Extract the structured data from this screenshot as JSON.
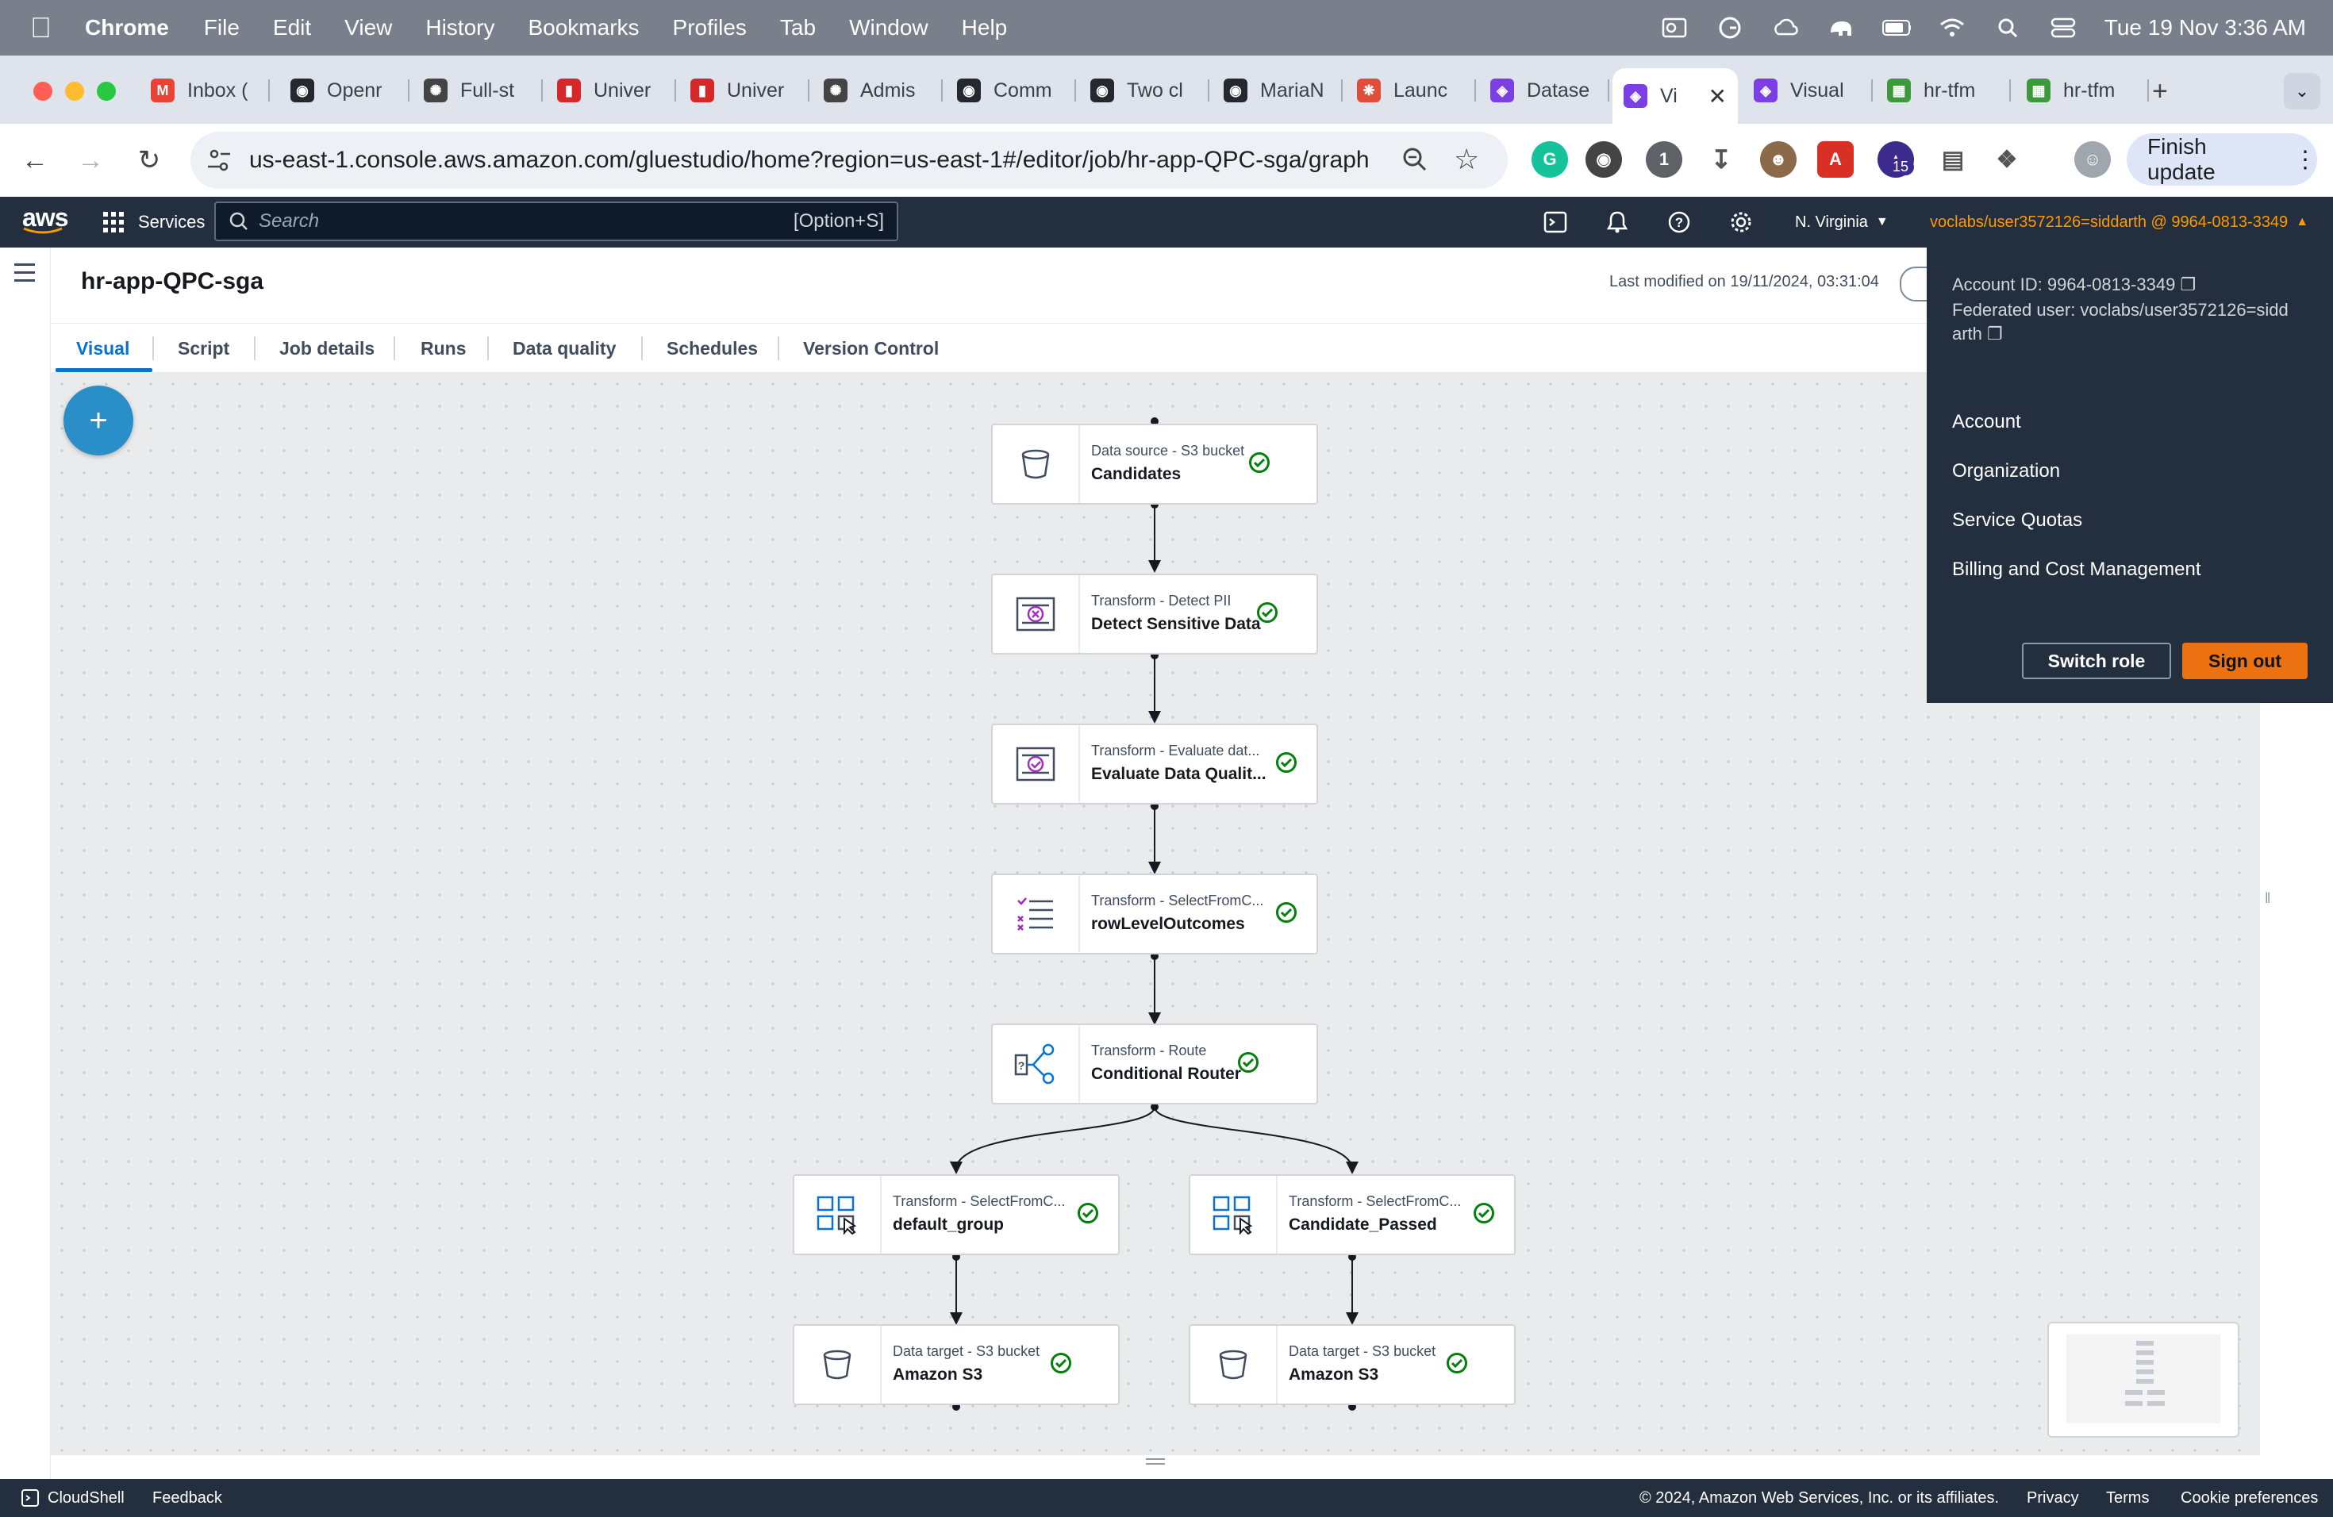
{
  "menubar": {
    "app": "Chrome",
    "items": [
      "File",
      "Edit",
      "View",
      "History",
      "Bookmarks",
      "Profiles",
      "Tab",
      "Window",
      "Help"
    ],
    "clock": "Tue 19 Nov  3:36 AM"
  },
  "browser": {
    "tabs": [
      {
        "label": "Inbox (",
        "icon": "gmail-icon",
        "color": "#ea4335"
      },
      {
        "label": "Openr",
        "icon": "github-icon",
        "color": "#24292f"
      },
      {
        "label": "Full-st",
        "icon": "chatgpt-icon",
        "color": "#444"
      },
      {
        "label": "Univer",
        "icon": "university-icon",
        "color": "#d62828"
      },
      {
        "label": "Univer",
        "icon": "university-icon",
        "color": "#d62828"
      },
      {
        "label": "Admis",
        "icon": "chatgpt-icon",
        "color": "#444"
      },
      {
        "label": "Comm",
        "icon": "github-icon",
        "color": "#24292f"
      },
      {
        "label": "Two cl",
        "icon": "github-icon",
        "color": "#24292f"
      },
      {
        "label": "MariaN",
        "icon": "github-icon",
        "color": "#24292f"
      },
      {
        "label": "Launc",
        "icon": "launch-icon",
        "color": "#e04e39"
      },
      {
        "label": "Datase",
        "icon": "glue-icon",
        "color": "#7b3fe4"
      },
      {
        "label": "Vi",
        "icon": "glue-icon",
        "color": "#7b3fe4"
      },
      {
        "label": "Visual",
        "icon": "glue-icon",
        "color": "#7b3fe4"
      },
      {
        "label": "hr-tfm",
        "icon": "sheet-icon",
        "color": "#3c9a3c"
      },
      {
        "label": "hr-tfm",
        "icon": "sheet-icon",
        "color": "#3c9a3c"
      }
    ],
    "url": "us-east-1.console.aws.amazon.com/gluestudio/home?region=us-east-1#/editor/job/hr-app-QPC-sga/graph",
    "finish_update": "Finish update",
    "ext_badge": "15"
  },
  "aws": {
    "logo": "aws",
    "services": "Services",
    "search_placeholder": "Search",
    "search_shortcut": "[Option+S]",
    "region": "N. Virginia",
    "account_link": "voclabs/user3572126=siddarth @ 9964-0813-3349"
  },
  "job": {
    "title": "hr-app-QPC-sga",
    "last_modified": "Last modified on 19/11/2024, 03:31:04",
    "tabs": [
      "Visual",
      "Script",
      "Job details",
      "Runs",
      "Data quality",
      "Schedules",
      "Version Control"
    ]
  },
  "nodes": [
    {
      "type": "Data source - S3 bucket",
      "name": "Candidates",
      "icon": "bucket-icon"
    },
    {
      "type": "Transform - Detect PII",
      "name": "Detect Sensitive Data",
      "icon": "detect-pii-icon"
    },
    {
      "type": "Transform - Evaluate dat...",
      "name": "Evaluate Data Qualit...",
      "icon": "data-quality-icon"
    },
    {
      "type": "Transform - SelectFromC...",
      "name": "rowLevelOutcomes",
      "icon": "select-list-icon"
    },
    {
      "type": "Transform - Route",
      "name": "Conditional Router",
      "icon": "router-icon"
    },
    {
      "type": "Transform - SelectFromC...",
      "name": "default_group",
      "icon": "select-grid-icon"
    },
    {
      "type": "Transform - SelectFromC...",
      "name": "Candidate_Passed",
      "icon": "select-grid-icon"
    },
    {
      "type": "Data target - S3 bucket",
      "name": "Amazon S3",
      "icon": "bucket-icon"
    },
    {
      "type": "Data target - S3 bucket",
      "name": "Amazon S3",
      "icon": "bucket-icon"
    }
  ],
  "account_menu": {
    "account_id": "Account ID: 9964-0813-3349",
    "federated_1": "Federated user: voclabs/user3572126=sidd",
    "federated_2": "arth",
    "items": [
      "Account",
      "Organization",
      "Service Quotas",
      "Billing and Cost Management"
    ],
    "switch_role": "Switch role",
    "sign_out": "Sign out"
  },
  "footer": {
    "cloudshell": "CloudShell",
    "feedback": "Feedback",
    "copyright": "© 2024, Amazon Web Services, Inc. or its affiliates.",
    "privacy": "Privacy",
    "terms": "Terms",
    "cookies": "Cookie preferences"
  },
  "colors": {
    "aws_nav": "#232f3e",
    "accent_blue": "#0972d3",
    "sign_out": "#ec7211",
    "account_link": "#ff9900",
    "success": "#037f0c"
  }
}
